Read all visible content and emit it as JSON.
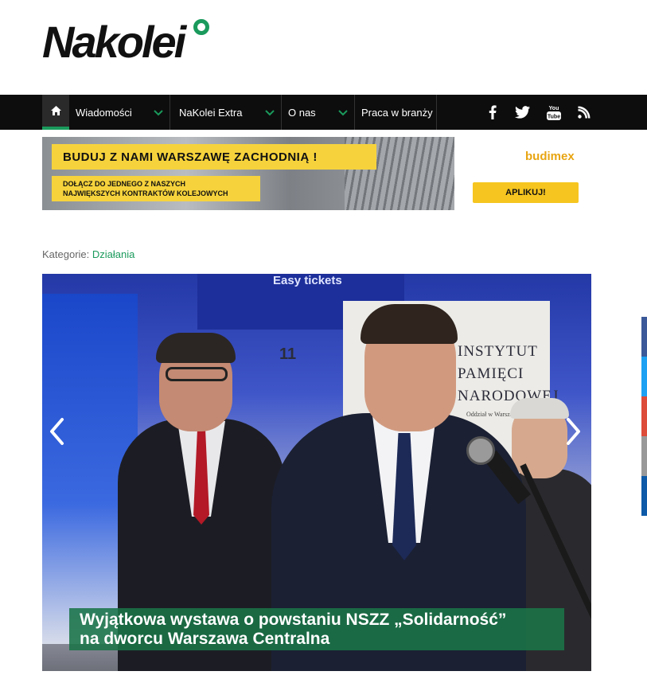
{
  "site": {
    "logo_text": "Nakolei"
  },
  "nav": {
    "items": [
      {
        "label": "Wiadomości",
        "has_dropdown": true
      },
      {
        "label": "NaKolei Extra",
        "has_dropdown": true
      },
      {
        "label": "O nas",
        "has_dropdown": true
      },
      {
        "label": "Praca w branży",
        "has_dropdown": false
      }
    ],
    "social": [
      "facebook-icon",
      "twitter-icon",
      "youtube-icon",
      "rss-icon"
    ],
    "accent": "#1a9a5c"
  },
  "banner": {
    "headline": "BUDUJ Z NAMI WARSZAWĘ ZACHODNIĄ !",
    "sub_line1": "DOŁĄCZ DO JEDNEGO  Z NASZYCH",
    "sub_line2": "NAJWIĘKSZYCH KONTRAKTÓW  KOLEJOWYCH",
    "brand": "budimex",
    "cta": "APLIKUJ!"
  },
  "article": {
    "categories_label": "Kategorie:",
    "category": "Działania",
    "photo": {
      "sign_text": "Easy tickets",
      "platform_number": "11",
      "board_lines": [
        "INSTYTUT",
        "PAMIĘCI",
        "NARODOWEJ"
      ],
      "board_subtitle": "Oddział w Warszawie"
    },
    "caption_line1": "Wyjątkowa wystawa o powstaniu NSZZ „Solidarność”",
    "caption_line2": "na dworcu Warszawa Centralna"
  },
  "share_colors": [
    "#3b5998",
    "#1da1f2",
    "#dd4b39",
    "#999999",
    "#0e5aa8"
  ]
}
